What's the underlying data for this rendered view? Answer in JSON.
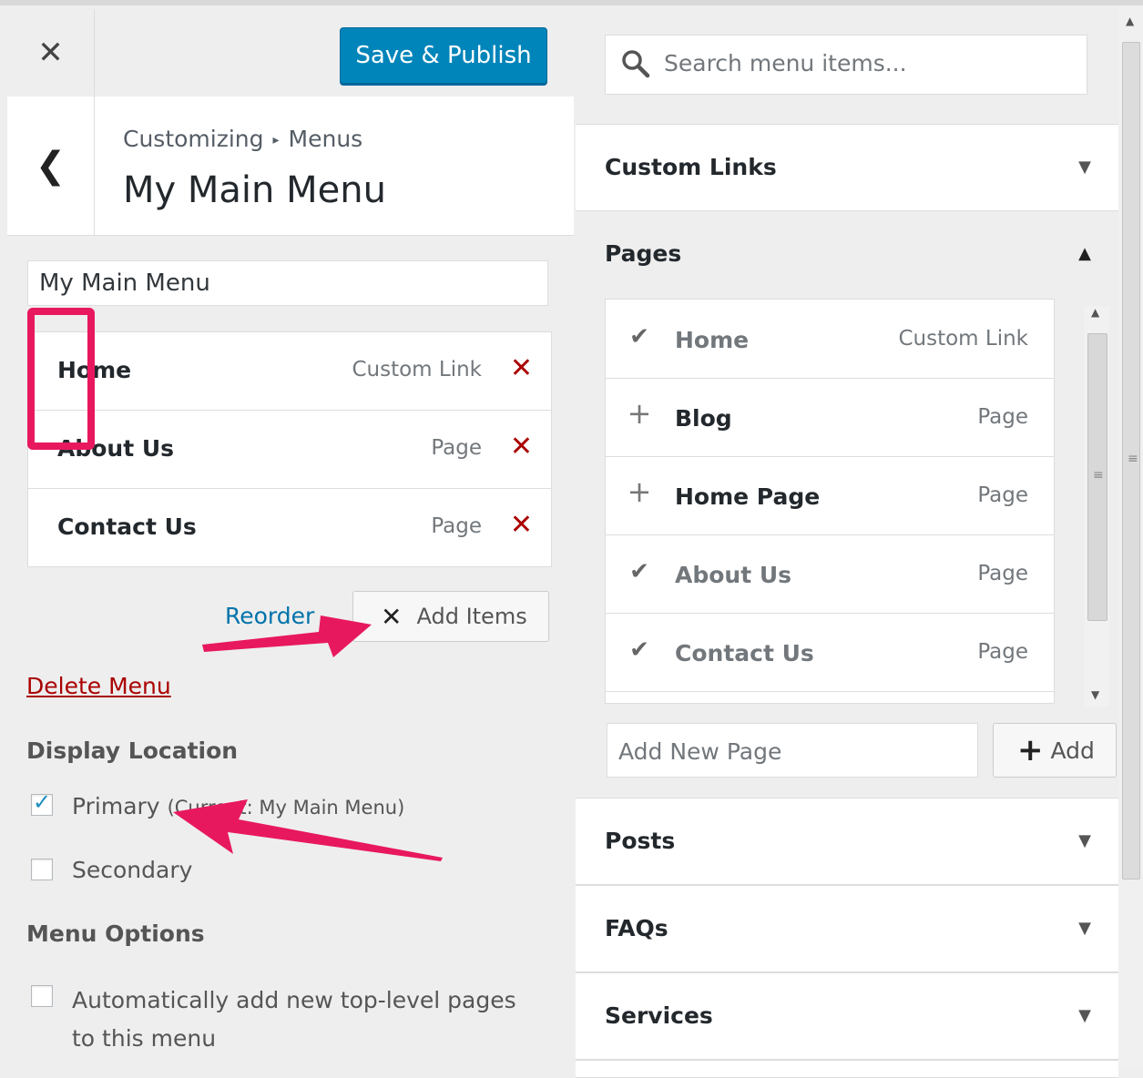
{
  "header": {
    "close_icon": "close-icon",
    "save_label": "Save & Publish"
  },
  "breadcrumb": {
    "part1": "Customizing",
    "separator": "▸",
    "part2": "Menus"
  },
  "menu_title": "My Main Menu",
  "menu_name_value": "My Main Menu",
  "menu_items": [
    {
      "title": "Home",
      "type": "Custom Link"
    },
    {
      "title": "About Us",
      "type": "Page"
    },
    {
      "title": "Contact Us",
      "type": "Page"
    }
  ],
  "reorder_label": "Reorder",
  "add_items_label": "Add Items",
  "delete_menu_label": "Delete Menu",
  "display_location": {
    "title": "Display Location",
    "primary_label": "Primary",
    "primary_current": "(Current: My Main Menu)",
    "primary_checked": true,
    "secondary_label": "Secondary",
    "secondary_checked": false
  },
  "menu_options": {
    "title": "Menu Options",
    "auto_add_label": "Automatically add new top-level pages to this menu",
    "auto_add_checked": false
  },
  "search": {
    "placeholder": "Search menu items..."
  },
  "sections": {
    "custom_links": "Custom Links",
    "pages": "Pages",
    "posts": "Posts",
    "faqs": "FAQs",
    "services": "Services"
  },
  "pages_list": [
    {
      "title": "Home",
      "type": "Custom Link",
      "state": "added"
    },
    {
      "title": "Blog",
      "type": "Page",
      "state": "add"
    },
    {
      "title": "Home Page",
      "type": "Page",
      "state": "add"
    },
    {
      "title": "About Us",
      "type": "Page",
      "state": "added"
    },
    {
      "title": "Contact Us",
      "type": "Page",
      "state": "added"
    }
  ],
  "new_page": {
    "placeholder": "Add New Page",
    "add_label": "Add"
  },
  "colors": {
    "primary_button": "#0085ba",
    "remove_x": "#aa0000",
    "link": "#0073aa",
    "annotation": "#e8185f"
  }
}
